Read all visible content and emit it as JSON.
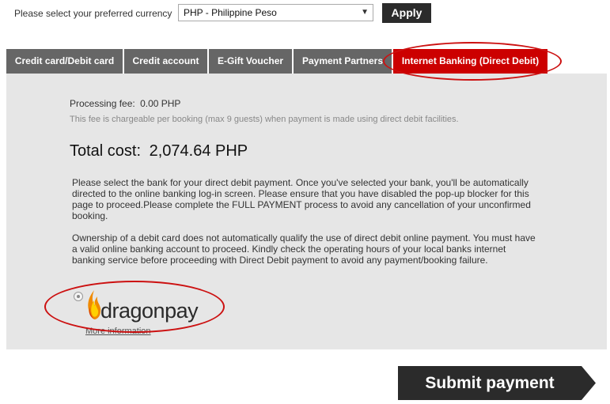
{
  "currency": {
    "label": "Please select your preferred currency",
    "selected": "PHP - Philippine Peso",
    "apply_label": "Apply"
  },
  "tabs": [
    {
      "label": "Credit card/Debit card",
      "active": false
    },
    {
      "label": "Credit account",
      "active": false
    },
    {
      "label": "E-Gift Voucher",
      "active": false
    },
    {
      "label": "Payment Partners",
      "active": false
    },
    {
      "label": "Internet Banking (Direct Debit)",
      "active": true
    }
  ],
  "payment": {
    "fee_label": "Processing fee:",
    "fee_value": "0.00 PHP",
    "fee_note": "This fee is chargeable per booking (max 9 guests) when payment is made using direct debit facilities.",
    "total_label": "Total cost:",
    "total_value": "2,074.64 PHP",
    "para1_lines": [
      "Please select the bank for your direct debit payment. Once you've selected your bank, you'll be automatically",
      "directed to the online banking log-in screen. Please ensure that you have disabled the pop-up blocker for this",
      "page to proceed.Please complete the FULL PAYMENT process to avoid any cancellation of your unconfirmed",
      "booking."
    ],
    "para2_lines": [
      "Ownership of a debit card does not automatically qualify the use of direct debit online payment. You must have",
      "a valid online banking account to proceed. Kindly check the operating hours of your local banks internet",
      "banking service before proceeding with Direct Debit payment to avoid any payment/booking failure."
    ]
  },
  "provider": {
    "logo_text": "dragonpay",
    "more_info": "More information",
    "selected": true
  },
  "submit_label": "Submit payment",
  "colors": {
    "tab_bg": "#666666",
    "tab_active": "#cc0000",
    "panel_bg": "#e6e6e6",
    "annotation_red": "#cc1111",
    "button_dark": "#2b2b2b"
  }
}
